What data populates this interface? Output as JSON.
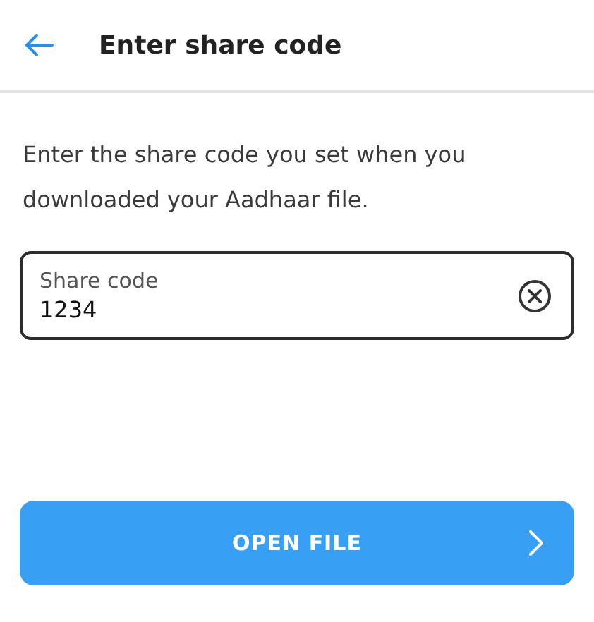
{
  "header": {
    "title": "Enter share code"
  },
  "instructions": "Enter the share code you set when you downloaded your Aadhaar file.",
  "share_code_field": {
    "label": "Share code",
    "value": "1234"
  },
  "primary_button": {
    "label": "OPEN FILE"
  }
}
